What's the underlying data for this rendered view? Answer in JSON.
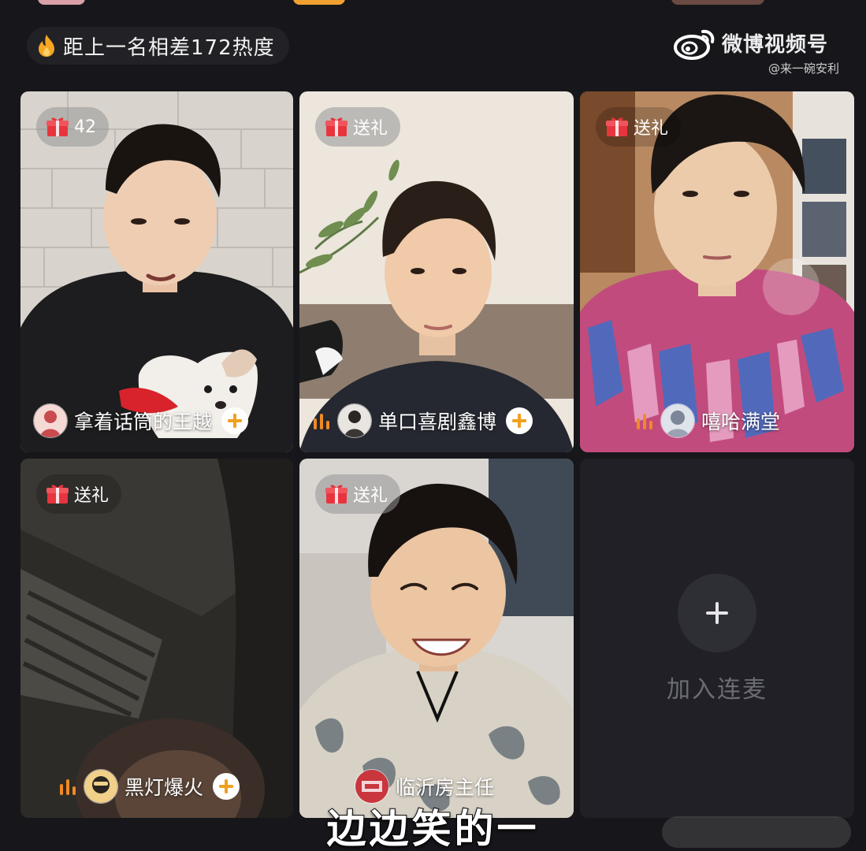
{
  "banner": {
    "heat_text": "距上一名相差172热度",
    "icon": "flame-icon"
  },
  "watermark": {
    "title": "微博视频号",
    "handle": "@来一碗安利",
    "icon": "weibo-icon"
  },
  "tiles": [
    {
      "gift_label": "42",
      "host_name": "拿着话筒的王越",
      "speaking": false,
      "follow": true
    },
    {
      "gift_label": "送礼",
      "host_name": "单口喜剧鑫博",
      "speaking": true,
      "follow": true
    },
    {
      "gift_label": "送礼",
      "host_name": "嘻哈满堂",
      "speaking": true,
      "follow": false
    },
    {
      "gift_label": "送礼",
      "host_name": "黑灯爆火",
      "speaking": true,
      "follow": true
    },
    {
      "gift_label": "送礼",
      "host_name": "临沂房主任",
      "speaking": false,
      "follow": false
    }
  ],
  "join_slot": {
    "label": "加入连麦",
    "icon": "plus-icon"
  },
  "subtitle": "边边笑的一",
  "colors": {
    "background": "#17171b",
    "gift_red": "#e8343f",
    "flame_orange": "#f5a623",
    "mic_orange": "#f08a24"
  }
}
